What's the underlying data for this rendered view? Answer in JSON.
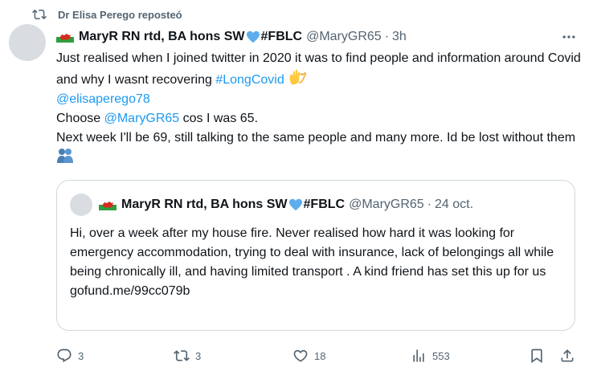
{
  "repost": {
    "label": "Dr Elisa Perego reposteó",
    "icon": "repost-icon"
  },
  "tweet": {
    "author_name": "MaryR RN rtd, BA hons SW",
    "author_name_suffix": "#FBLC",
    "author_handle": "@MaryGR65",
    "time": "3h",
    "text_line1": "Just realised when I joined twitter in 2020 it was to find people and information around Covid and why I wasnt recovering ",
    "hashtag": "#LongCovid",
    "mention1": "@elisaperego78",
    "text_choose_pre": "Choose ",
    "mention2": "@MaryGR65",
    "text_choose_post": " cos I was 65.",
    "text_line4": "Next week I'll be 69, still talking to the same people and many more. Id be lost without them"
  },
  "quote": {
    "author_name": "MaryR RN rtd, BA hons SW",
    "author_name_suffix": "#FBLC",
    "author_handle": "@MaryGR65",
    "time": "24 oct.",
    "text": "Hi, over a week after my house fire. Never realised how hard it was looking for emergency accommodation, trying to deal with insurance, lack of belongings all while being chronically ill, and having limited transport . A kind friend has set this up for us",
    "link": "gofund.me/99cc079b"
  },
  "actions": {
    "replies": "3",
    "reposts": "3",
    "likes": "18",
    "views": "553"
  },
  "colors": {
    "accent": "#1d9bf0",
    "secondary_text": "#536471",
    "border": "#cfd9de"
  },
  "icons": [
    "repost-icon",
    "wales-flag-icon",
    "blue-heart-icon",
    "more-icon",
    "waving-hands-icon",
    "people-hugging-icon",
    "reply-icon",
    "like-icon",
    "views-icon",
    "bookmark-icon",
    "share-icon"
  ]
}
